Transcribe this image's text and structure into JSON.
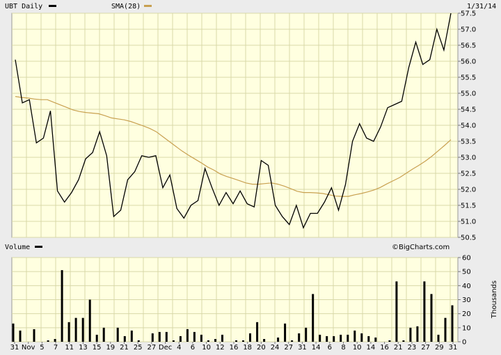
{
  "header": {
    "symbol_label": "UBT Daily",
    "sma_label": "SMA(28)",
    "date": "1/31/14",
    "price_color": "#000000",
    "sma_color": "#c8a050"
  },
  "volume_panel": {
    "label": "Volume",
    "watermark": "©BigCharts.com",
    "units": "Thousands"
  },
  "chart_data": [
    {
      "type": "line",
      "title": "UBT Daily",
      "ylim": [
        50.5,
        57.5
      ],
      "y_ticks": [
        "50.5",
        "51.0",
        "51.5",
        "52.0",
        "52.5",
        "53.0",
        "53.5",
        "54.0",
        "54.5",
        "55.0",
        "55.5",
        "56.0",
        "56.5",
        "57.0",
        "57.5"
      ],
      "grid": true,
      "series": [
        {
          "name": "UBT Daily",
          "values": [
            56.05,
            54.7,
            54.8,
            53.45,
            53.6,
            54.45,
            51.95,
            51.6,
            51.9,
            52.3,
            52.95,
            53.15,
            53.8,
            53.05,
            51.15,
            51.35,
            52.3,
            52.55,
            53.05,
            53.0,
            53.05,
            52.05,
            52.45,
            51.4,
            51.1,
            51.5,
            51.65,
            52.65,
            52.05,
            51.5,
            51.9,
            51.55,
            51.95,
            51.55,
            51.45,
            52.9,
            52.75,
            51.5,
            51.15,
            50.9,
            51.5,
            50.8,
            51.25,
            51.25,
            51.6,
            52.05,
            51.35,
            52.15,
            53.5,
            54.05,
            53.6,
            53.5,
            53.95,
            54.55,
            54.65,
            54.75,
            55.8,
            56.6,
            55.9,
            56.05,
            57.0,
            56.35,
            57.5
          ]
        },
        {
          "name": "SMA(28)",
          "values": [
            54.9,
            54.87,
            54.85,
            54.82,
            54.8,
            54.8,
            54.72,
            54.64,
            54.56,
            54.48,
            54.43,
            54.4,
            54.38,
            54.36,
            54.3,
            54.23,
            54.2,
            54.17,
            54.12,
            54.05,
            53.98,
            53.9,
            53.8,
            53.65,
            53.5,
            53.35,
            53.2,
            53.07,
            52.95,
            52.83,
            52.7,
            52.6,
            52.48,
            52.4,
            52.34,
            52.27,
            52.2,
            52.16,
            52.16,
            52.18,
            52.2,
            52.16,
            52.1,
            52.02,
            51.94,
            51.9,
            51.9,
            51.89,
            51.87,
            51.83,
            51.79,
            51.78,
            51.78,
            51.83,
            51.87,
            51.92,
            51.98,
            52.06,
            52.17,
            52.27,
            52.37,
            52.5,
            52.63,
            52.75,
            52.88,
            53.03,
            53.2,
            53.37,
            53.55
          ]
        }
      ]
    },
    {
      "type": "bar",
      "title": "Volume",
      "ylabel": "Thousands",
      "ylim": [
        0,
        60
      ],
      "y_ticks": [
        "0",
        "10",
        "20",
        "30",
        "40",
        "50",
        "60"
      ],
      "grid": true,
      "x_labels": [
        "31",
        "Nov",
        "5",
        "7",
        "11",
        "13",
        "15",
        "19",
        "21",
        "25",
        "27",
        "Dec",
        "4",
        "6",
        "10",
        "12",
        "16",
        "18",
        "20",
        "24",
        "27",
        "31",
        "14",
        "6",
        "8",
        "10",
        "14",
        "16",
        "21",
        "23",
        "27",
        "29",
        "31"
      ],
      "values": [
        13,
        8,
        0,
        9,
        0,
        1,
        2,
        51,
        14,
        17,
        17,
        30,
        5,
        10,
        0,
        10,
        4,
        8,
        1,
        0,
        6,
        7,
        7,
        1,
        4,
        9,
        7,
        5,
        1,
        2,
        5,
        0,
        1,
        1,
        6,
        14,
        2,
        0,
        3,
        13,
        1,
        6,
        10,
        34,
        5,
        4,
        4,
        5,
        5,
        8,
        6,
        4,
        3,
        0,
        1,
        43,
        1,
        10,
        11,
        43,
        34,
        5,
        17,
        26
      ]
    }
  ]
}
